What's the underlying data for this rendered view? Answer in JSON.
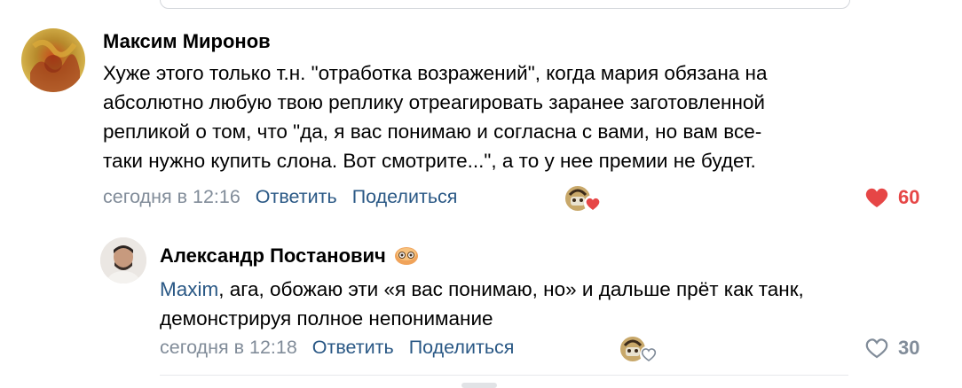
{
  "comments": [
    {
      "author": "Максим Миронов",
      "lines": [
        "Хуже этого только т.н. \"отработка возражений\", когда мария обязана на",
        "абсолютно любую твою реплику отреагировать заранее заготовленной",
        "репликой о том, что \"да, я вас понимаю и согласна с вами, но вам все-",
        "таки нужно купить слона. Вот смотрите...\", а то у нее премии не будет."
      ],
      "time": "сегодня в 12:16",
      "reply_label": "Ответить",
      "share_label": "Поделиться",
      "likes": "60",
      "liked": true,
      "heart_color": "#e64646"
    },
    {
      "author": "Александр Постанович",
      "mention": "Maxim",
      "first_line_rest": ", ага, обожаю эти «я вас понимаю, но» и дальше прёт как танк,",
      "second_line": "демонстрируя полное непонимание",
      "time": "сегодня в 12:18",
      "reply_label": "Ответить",
      "share_label": "Поделиться",
      "likes": "30",
      "liked": false
    }
  ],
  "colors": {
    "link": "#2a5885",
    "muted": "#818c99",
    "like_active": "#e64646",
    "like_inactive": "#818c99"
  },
  "icons": {
    "like": "heart-icon",
    "reaction": "reaction-sticker-icon",
    "badge": "donut-emoji-icon"
  }
}
